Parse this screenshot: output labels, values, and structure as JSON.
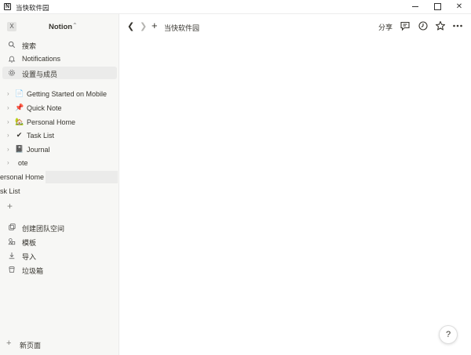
{
  "window": {
    "title": "当快软件园"
  },
  "workspace": {
    "badge": "X",
    "name": "Notion"
  },
  "sidebar": {
    "nav": [
      {
        "label": "搜索",
        "icon": "search-icon"
      },
      {
        "label": "Notifications",
        "icon": "bell-icon"
      },
      {
        "label": "设置与成员",
        "icon": "gear-icon",
        "active": true
      }
    ],
    "pages": [
      {
        "label": "Getting Started on Mobile",
        "emoji": "📄"
      },
      {
        "label": "Quick Note",
        "emoji": "📌"
      },
      {
        "label": "Personal Home",
        "emoji": "🏡"
      },
      {
        "label": "Task List",
        "emoji": "✔"
      },
      {
        "label": "Journal",
        "emoji": "📓"
      },
      {
        "label": "ote",
        "emoji": ""
      }
    ],
    "ghost_items": [
      {
        "label": "ersonal Home"
      },
      {
        "label": "sk List"
      }
    ],
    "tools": [
      {
        "label": "创建团队空间",
        "icon": "team-icon"
      },
      {
        "label": "模板",
        "icon": "template-icon"
      },
      {
        "label": "导入",
        "icon": "import-icon"
      },
      {
        "label": "垃圾箱",
        "icon": "trash-icon"
      }
    ],
    "new_page": "新页面"
  },
  "topbar": {
    "breadcrumb": "当快软件园",
    "share": "分享"
  },
  "help": "?"
}
